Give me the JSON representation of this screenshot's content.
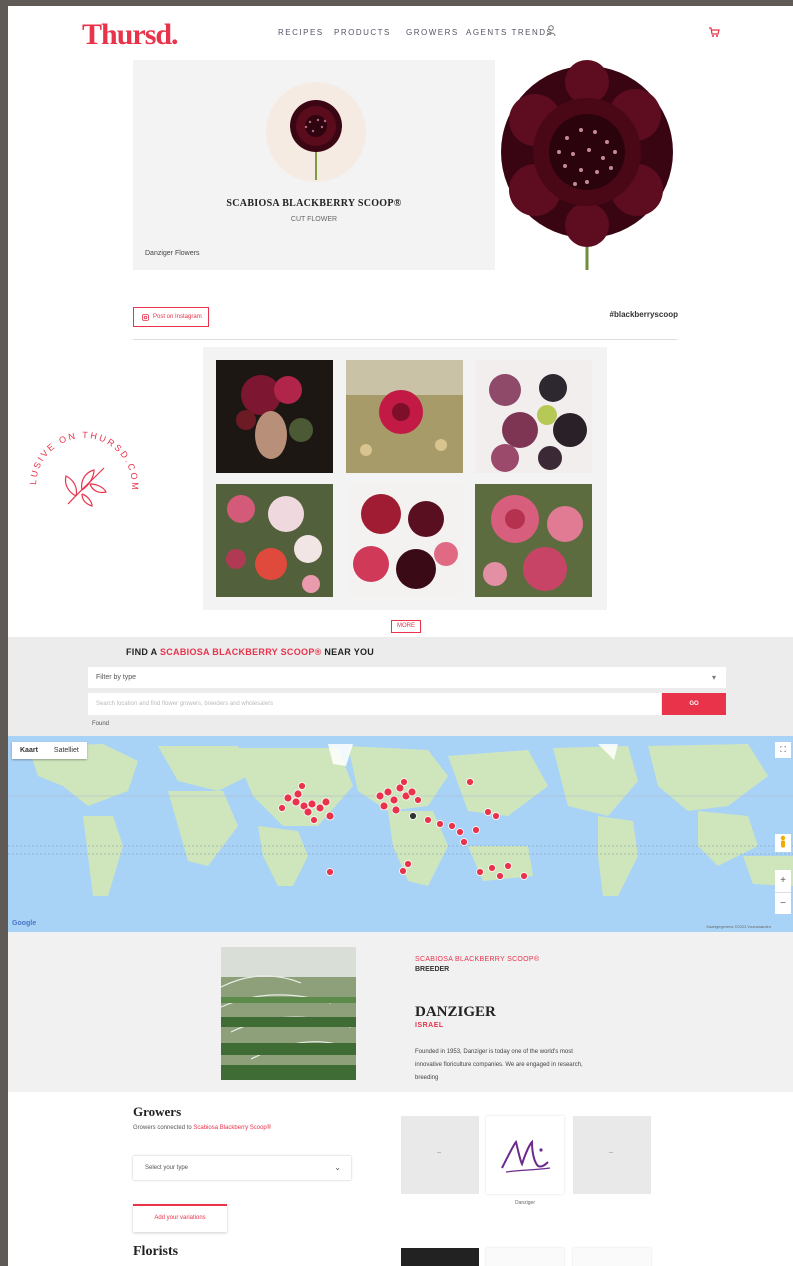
{
  "header": {
    "logo": "Thursd.",
    "nav": [
      "RECIPES",
      "PRODUCTS",
      "GROWERS",
      "AGENTS TRENDS"
    ]
  },
  "hero": {
    "title": "SCABIOSA BLACKBERRY SCOOP®",
    "subtitle": "CUT FLOWER",
    "brand": "Danziger Flowers"
  },
  "social": {
    "button_label": "Post on Instagram",
    "hashtag": "#blackberryscoop"
  },
  "gallery": {
    "more_label": "MORE"
  },
  "stamp": {
    "text": "EXCLUSIVE ON THURSD.COM"
  },
  "find": {
    "title_prefix": "FIND A ",
    "title_highlight": "SCABIOSA BLACKBERRY SCOOP®",
    "title_suffix": " NEAR YOU",
    "filter_placeholder": "Filter by type",
    "search_placeholder": "Search location and find flower growers, breeders and wholesalers",
    "search_button": "GO",
    "found_label": "Found"
  },
  "map": {
    "tab_map": "Kaart",
    "tab_satellite": "Satelliet",
    "fullscreen_icon": "fullscreen-icon",
    "zoom_in": "+",
    "zoom_out": "−",
    "google": "Google",
    "map_data": "Kaartgegevens ©2023 Voorwaarden"
  },
  "grower_section": {
    "line1": "SCABIOSA BLACKBERRY SCOOP®",
    "line2": "BREEDER",
    "name": "DANZIGER",
    "country": "ISRAEL",
    "description": "Founded in 1953, Danziger is today one of the world's most innovative floriculture companies. We are engaged in research, breeding"
  },
  "growers": {
    "title": "Growers",
    "subtitle_prefix": "Growers connected to ",
    "subtitle_highlight": "Scabiosa Blackberry Scoop®",
    "select_placeholder": "Select your type",
    "add_button": "Add your variations",
    "card_label": "Danziger"
  },
  "florists": {
    "title": "Florists"
  },
  "colors": {
    "accent": "#e8334b",
    "map_water": "#a9d3f6",
    "map_land": "#cfe6bd"
  }
}
